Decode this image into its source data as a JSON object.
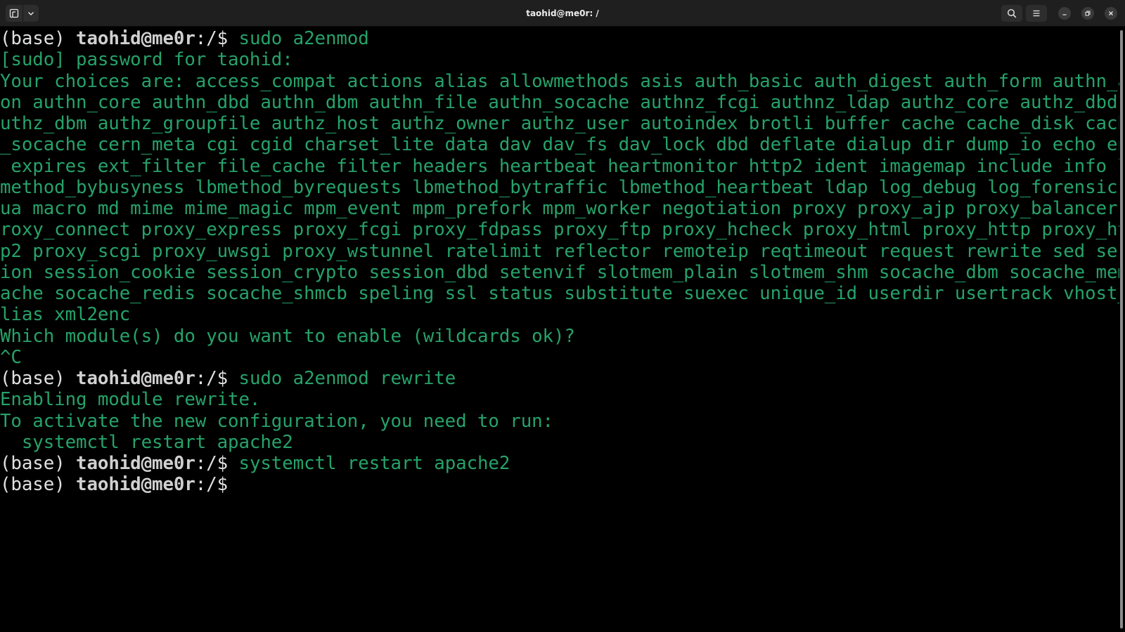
{
  "window": {
    "title": "taohid@me0r: /"
  },
  "colors": {
    "terminal_background": "#000000",
    "terminal_text": "#26a269",
    "prompt_text": "#e0e0e0",
    "titlebar": "#1f1f1f"
  },
  "icons": {
    "new_tab": "new-tab-icon",
    "tab_menu": "chevron-down-icon",
    "search": "search-icon",
    "menu": "hamburger-menu-icon",
    "minimize": "minimize-icon",
    "maximize": "restore-icon",
    "close": "close-icon"
  },
  "terminal": {
    "prompt": {
      "env": "(base) ",
      "user_host": "taohid@me0r",
      "path": ":/$ "
    },
    "lines": [
      {
        "type": "prompt",
        "command": "sudo a2enmod"
      },
      {
        "type": "output",
        "text": "[sudo] password for taohid:"
      },
      {
        "type": "output",
        "text": "Your choices are: access_compat actions alias allowmethods asis auth_basic auth_digest auth_form authn_an"
      },
      {
        "type": "output",
        "text": "on authn_core authn_dbd authn_dbm authn_file authn_socache authnz_fcgi authnz_ldap authz_core authz_dbd a"
      },
      {
        "type": "output",
        "text": "uthz_dbm authz_groupfile authz_host authz_owner authz_user autoindex brotli buffer cache cache_disk cache"
      },
      {
        "type": "output",
        "text": "_socache cern_meta cgi cgid charset_lite data dav dav_fs dav_lock dbd deflate dialup dir dump_io echo env"
      },
      {
        "type": "output",
        "text": " expires ext_filter file_cache filter headers heartbeat heartmonitor http2 ident imagemap include info lb"
      },
      {
        "type": "output",
        "text": "method_bybusyness lbmethod_byrequests lbmethod_bytraffic lbmethod_heartbeat ldap log_debug log_forensic l"
      },
      {
        "type": "output",
        "text": "ua macro md mime mime_magic mpm_event mpm_prefork mpm_worker negotiation proxy proxy_ajp proxy_balancer p"
      },
      {
        "type": "output",
        "text": "roxy_connect proxy_express proxy_fcgi proxy_fdpass proxy_ftp proxy_hcheck proxy_html proxy_http proxy_htt"
      },
      {
        "type": "output",
        "text": "p2 proxy_scgi proxy_uwsgi proxy_wstunnel ratelimit reflector remoteip reqtimeout request rewrite sed sess"
      },
      {
        "type": "output",
        "text": "ion session_cookie session_crypto session_dbd setenvif slotmem_plain slotmem_shm socache_dbm socache_memc"
      },
      {
        "type": "output",
        "text": "ache socache_redis socache_shmcb speling ssl status substitute suexec unique_id userdir usertrack vhost_a"
      },
      {
        "type": "output",
        "text": "lias xml2enc"
      },
      {
        "type": "output",
        "text": "Which module(s) do you want to enable (wildcards ok)?"
      },
      {
        "type": "output",
        "text": "^C"
      },
      {
        "type": "prompt",
        "command": "sudo a2enmod rewrite"
      },
      {
        "type": "output",
        "text": "Enabling module rewrite."
      },
      {
        "type": "output",
        "text": "To activate the new configuration, you need to run:"
      },
      {
        "type": "output",
        "text": "  systemctl restart apache2"
      },
      {
        "type": "prompt",
        "command": "systemctl restart apache2"
      },
      {
        "type": "prompt",
        "command": ""
      }
    ]
  }
}
